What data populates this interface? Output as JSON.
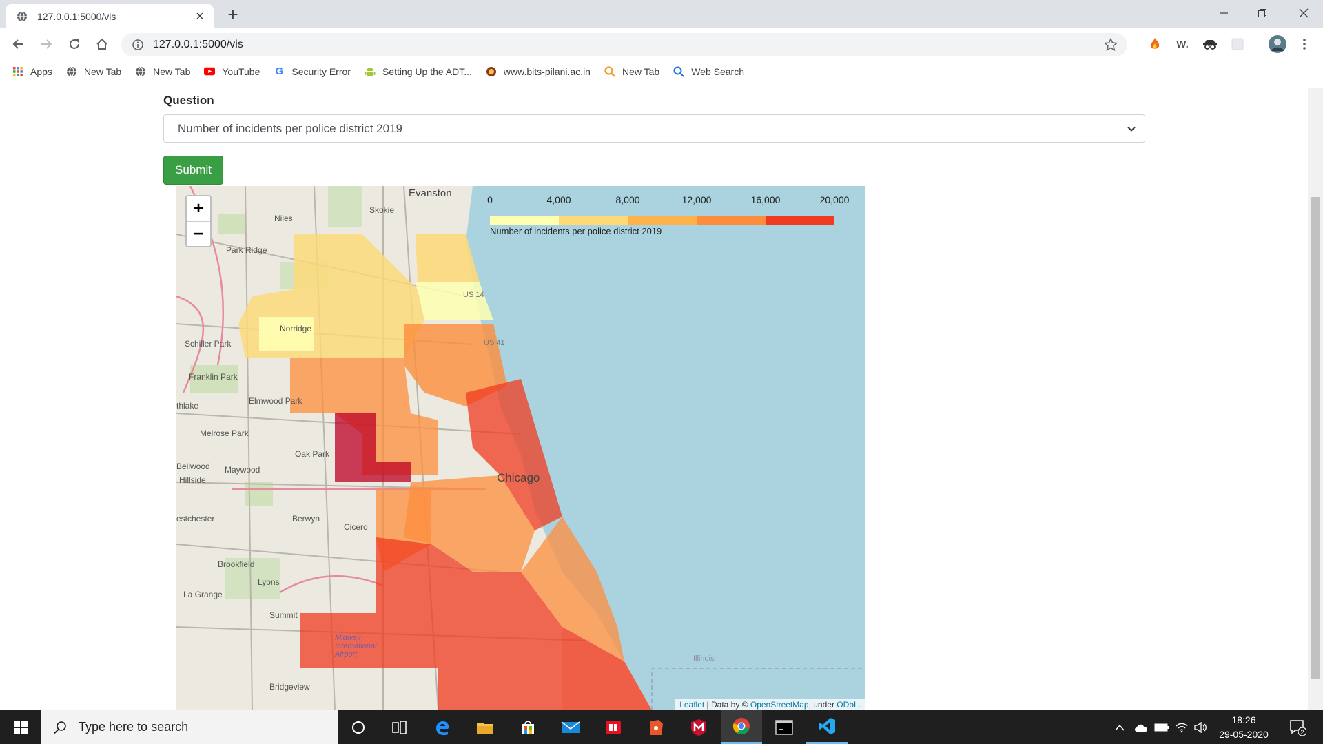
{
  "browser": {
    "tab_title": "127.0.0.1:5000/vis",
    "url": "127.0.0.1:5000/vis",
    "bookmarks": [
      {
        "label": "Apps",
        "icon": "apps-grid-icon"
      },
      {
        "label": "New Tab",
        "icon": "globe-icon"
      },
      {
        "label": "New Tab",
        "icon": "globe-icon"
      },
      {
        "label": "YouTube",
        "icon": "youtube-icon"
      },
      {
        "label": "Security Error",
        "icon": "google-icon"
      },
      {
        "label": "Setting Up the ADT...",
        "icon": "android-icon"
      },
      {
        "label": "www.bits-pilani.ac.in",
        "icon": "bits-logo-icon"
      },
      {
        "label": "New Tab",
        "icon": "search-magnifier-orange-icon"
      },
      {
        "label": "Web Search",
        "icon": "search-magnifier-blue-icon"
      }
    ]
  },
  "form": {
    "question_label": "Question",
    "selected_question": "Number of incidents per police district 2019",
    "submit_label": "Submit"
  },
  "map": {
    "zoom_in": "+",
    "zoom_out": "−",
    "legend": {
      "ticks": [
        "0",
        "4,000",
        "8,000",
        "12,000",
        "16,000",
        "20,000"
      ],
      "caption": "Number of incidents per police district 2019",
      "colors": [
        "#ffffb2",
        "#fed976",
        "#feb24c",
        "#fd8d3c",
        "#f03b20",
        "#bd0026"
      ]
    },
    "places": [
      "Evanston",
      "Skokie",
      "Niles",
      "Park Ridge",
      "Norridge",
      "Schiller Park",
      "Franklin Park",
      "Elmwood Park",
      "thlake",
      "Melrose Park",
      "Oak Park",
      "Bellwood",
      "Maywood",
      "Hillside",
      "Chicago",
      "Berwyn",
      "Cicero",
      "estchester",
      "Brookfield",
      "Lyons",
      "La Grange",
      "Summit",
      "Bridgeview",
      "Midway International Airport",
      "Illinois",
      "US 14",
      "US 41"
    ],
    "attribution": {
      "leaflet": "Leaflet",
      "data_by": " | Data by © ",
      "osm": "OpenStreetMap",
      "under": ", under ",
      "odbl": "ODbL",
      "end": "."
    }
  },
  "taskbar": {
    "search_placeholder": "Type here to search",
    "time": "18:26",
    "date": "29-05-2020",
    "notifications": "2"
  }
}
